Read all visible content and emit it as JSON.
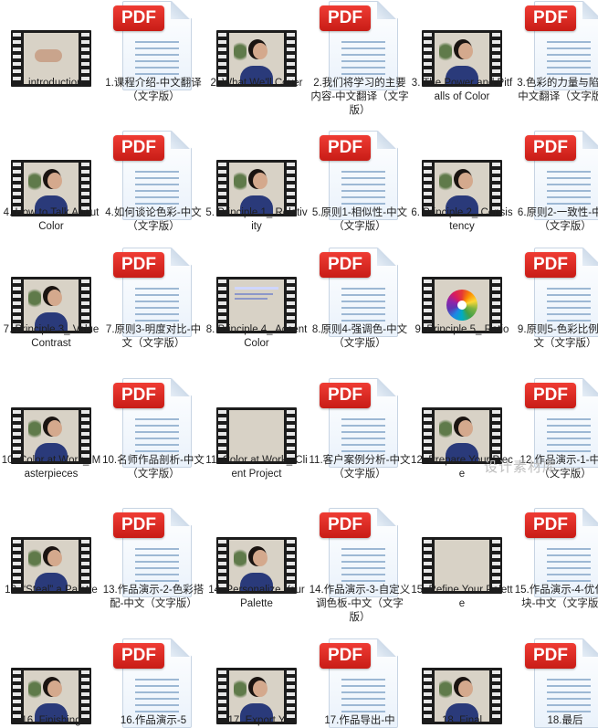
{
  "items": [
    {
      "type": "video",
      "scene": "hands",
      "label": "1.introduction"
    },
    {
      "type": "pdf",
      "label": "1.课程介绍-中文翻译（文字版）"
    },
    {
      "type": "video",
      "scene": "person",
      "label": "2. What We'll Cover"
    },
    {
      "type": "pdf",
      "label": "2.我们将学习的主要内容-中文翻译（文字版）"
    },
    {
      "type": "video",
      "scene": "person",
      "label": "3. The Power and Pitfalls of Color"
    },
    {
      "type": "pdf",
      "label": "3.色彩的力量与陷阱-中文翻译（文字版）"
    },
    {
      "type": "video",
      "scene": "person",
      "label": "4. How to Talk About Color"
    },
    {
      "type": "pdf",
      "label": "4.如何谈论色彩-中文（文字版）"
    },
    {
      "type": "video",
      "scene": "person",
      "label": "5. Principle 1_ Relativity"
    },
    {
      "type": "pdf",
      "label": "5.原则1-相似性-中文（文字版）"
    },
    {
      "type": "video",
      "scene": "person",
      "label": "6. Principle 2_ Consistency"
    },
    {
      "type": "pdf",
      "label": "6.原则2-一致性-中文（文字版）"
    },
    {
      "type": "video",
      "scene": "person",
      "label": "7. Principle 3_ Value Contrast"
    },
    {
      "type": "pdf",
      "label": "7.原则3-明度对比-中文（文字版）"
    },
    {
      "type": "video",
      "scene": "slide",
      "label": "8. Principle 4_ Accent Color"
    },
    {
      "type": "pdf",
      "label": "8.原则4-强调色-中文（文字版）"
    },
    {
      "type": "video",
      "scene": "wheel",
      "label": "9. Principle 5_ Ratio"
    },
    {
      "type": "pdf",
      "label": "9.原则5-色彩比例-中文（文字版）"
    },
    {
      "type": "video",
      "scene": "person",
      "label": "10. Color at Work_ Masterpieces"
    },
    {
      "type": "pdf",
      "label": "10.名师作品剖析-中文（文字版）"
    },
    {
      "type": "video",
      "scene": "forest",
      "label": "11. Color at Work_ Client Project"
    },
    {
      "type": "pdf",
      "label": "11.客户案例分析-中文（文字版）"
    },
    {
      "type": "video",
      "scene": "person",
      "label": "12. Prepare Your Piece"
    },
    {
      "type": "pdf",
      "label": "12.作品演示-1-中文（文字版）"
    },
    {
      "type": "video",
      "scene": "person",
      "label": "13. “Steal” a Palette"
    },
    {
      "type": "pdf",
      "label": "13.作品演示-2-色彩搭配-中文（文字版）"
    },
    {
      "type": "video",
      "scene": "person",
      "label": "14. Personalize Your Palette"
    },
    {
      "type": "pdf",
      "label": "14.作品演示-3-自定义调色板-中文（文字版）"
    },
    {
      "type": "video",
      "scene": "flower",
      "label": "15. Refine Your Palette"
    },
    {
      "type": "pdf",
      "label": "15.作品演示-4-优化色块-中文（文字版）"
    },
    {
      "type": "video",
      "scene": "person",
      "label": "16. Finishing"
    },
    {
      "type": "pdf",
      "label": "16.作品演示-5"
    },
    {
      "type": "video",
      "scene": "person",
      "label": "17. Export Y"
    },
    {
      "type": "pdf",
      "label": "17.作品导出-中"
    },
    {
      "type": "video",
      "scene": "person",
      "label": "18. Final"
    },
    {
      "type": "pdf",
      "label": "18.最后"
    }
  ],
  "watermark": "设计素材库"
}
